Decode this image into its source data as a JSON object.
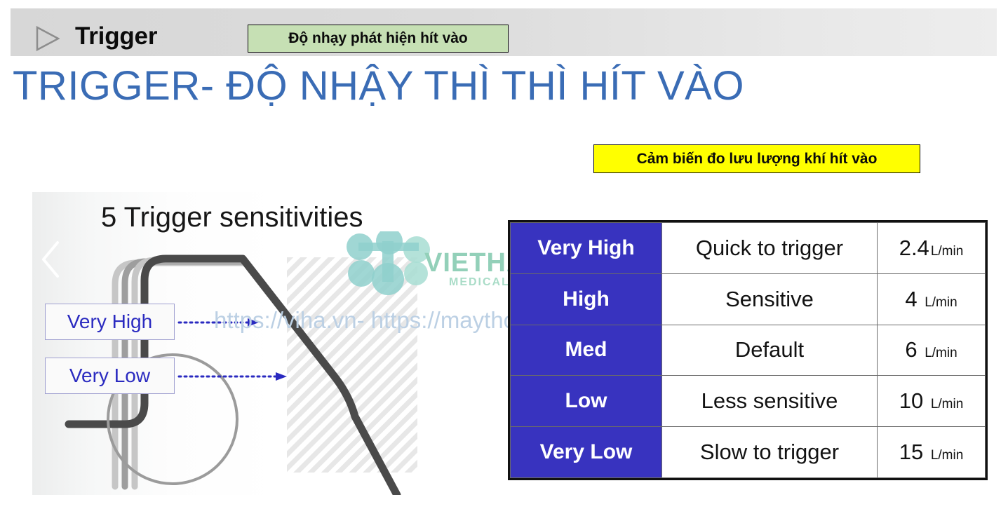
{
  "header": {
    "title": "Trigger",
    "triangle_icon": "play-triangle-icon",
    "callout": "Độ nhạy phát hiện hít vào"
  },
  "slide": {
    "title": "TRIGGER- ĐỘ NHẬY THÌ THÌ HÍT VÀO",
    "title_color": "#3a6cb5"
  },
  "yellow_callout": {
    "text": "Cảm biến đo lưu lượng khí hít vào",
    "background": "#ffff00"
  },
  "illustration": {
    "heading": "5 Trigger sensitivities",
    "prev_icon": "chevron-left-icon",
    "tags": [
      {
        "label": "Very High"
      },
      {
        "label": "Very Low"
      }
    ]
  },
  "watermark": {
    "url": "https://viha.vn- https://maytho.com.vn",
    "brand": "VIETHA",
    "sub": "MEDICAL",
    "brand_color": "#93d0b9"
  },
  "table": {
    "level_bg": "#3833bf",
    "rows": [
      {
        "level": "Very High",
        "description": "Quick to trigger",
        "value": "2.4",
        "unit": "L/min"
      },
      {
        "level": "High",
        "description": "Sensitive",
        "value": "4",
        "unit": "L/min"
      },
      {
        "level": "Med",
        "description": "Default",
        "value": "6",
        "unit": "L/min"
      },
      {
        "level": "Low",
        "description": "Less sensitive",
        "value": "10",
        "unit": "L/min"
      },
      {
        "level": "Very Low",
        "description": "Slow to trigger",
        "value": "15",
        "unit": "L/min"
      }
    ]
  }
}
